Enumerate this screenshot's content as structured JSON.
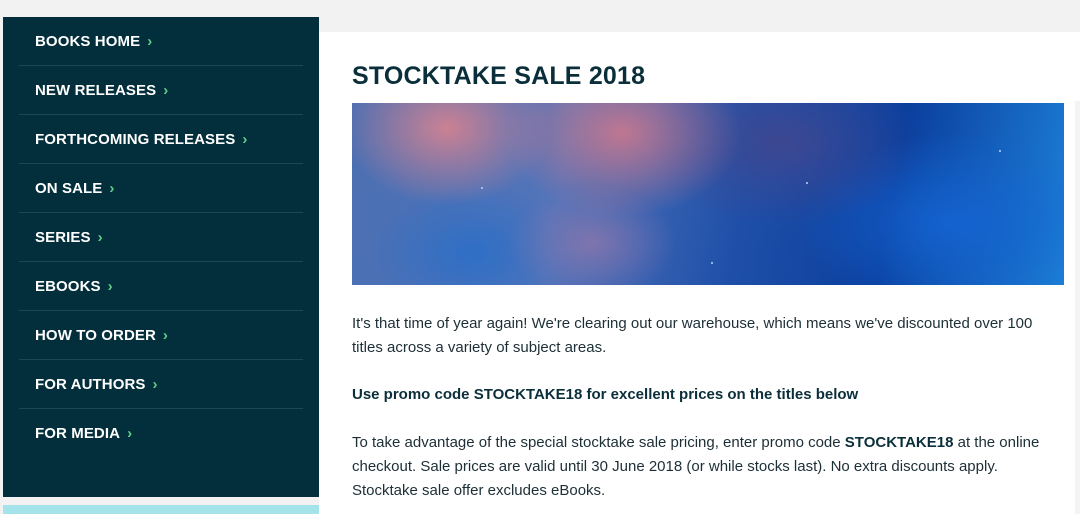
{
  "sidebar": {
    "items": [
      {
        "label": "BOOKS HOME"
      },
      {
        "label": "NEW RELEASES"
      },
      {
        "label": "FORTHCOMING RELEASES"
      },
      {
        "label": "ON SALE"
      },
      {
        "label": "SERIES"
      },
      {
        "label": "EBOOKS"
      },
      {
        "label": "HOW TO ORDER"
      },
      {
        "label": "FOR AUTHORS"
      },
      {
        "label": "FOR MEDIA"
      }
    ],
    "chevron": "›"
  },
  "main": {
    "title": "STOCKTAKE SALE 2018",
    "intro": "It's that time of year again! We're clearing out our warehouse, which means we've discounted over 100 titles across a variety of subject areas.",
    "promo_heading": "Use promo code STOCKTAKE18 for excellent prices on the titles below",
    "details_before": "To take advantage of the special stocktake sale pricing, enter promo code ",
    "details_code": "STOCKTAKE18",
    "details_after": " at the online checkout. Sale prices are valid until 30 June 2018 (or while stocks last). No extra discounts apply. Stocktake sale offer excludes eBooks."
  },
  "colors": {
    "sidebar_bg": "#022f3b",
    "chevron": "#5fd08a",
    "title": "#0b2f3a",
    "strip": "#a5e3ea"
  }
}
